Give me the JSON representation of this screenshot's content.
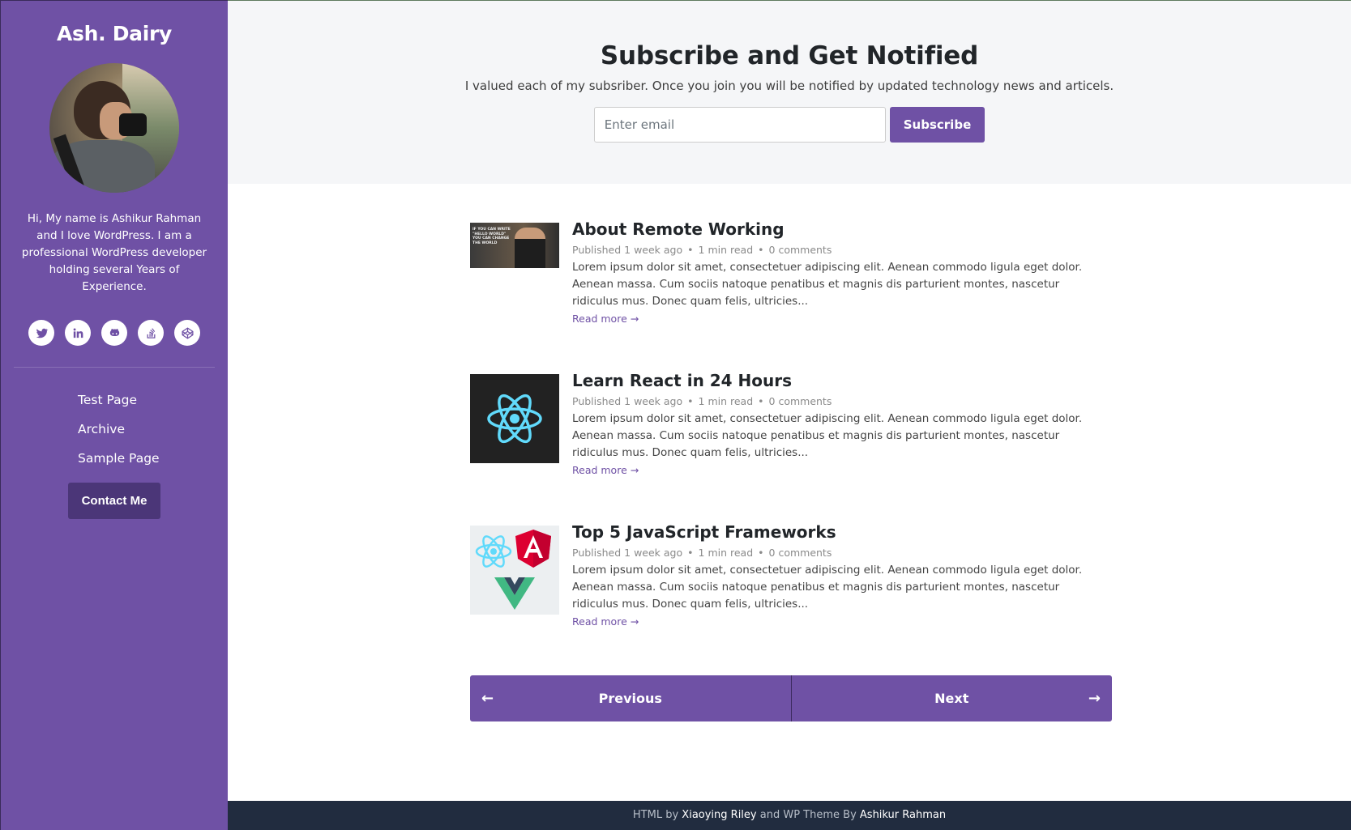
{
  "sidebar": {
    "site_title": "Ash. Dairy",
    "bio": "Hi, My name is Ashikur Rahman and I love WordPress. I am a professional WordPress developer holding several Years of Experience.",
    "social_icons": [
      "twitter-icon",
      "linkedin-icon",
      "github-icon",
      "stackoverflow-icon",
      "codepen-icon"
    ],
    "nav": [
      {
        "label": "Test Page"
      },
      {
        "label": "Archive"
      },
      {
        "label": "Sample Page"
      }
    ],
    "contact_label": "Contact Me"
  },
  "subscribe": {
    "title": "Subscribe and Get Notified",
    "description": "I valued each of my subsriber. Once you join you will be notified by updated technology news and articels.",
    "email_placeholder": "Enter email",
    "button_label": "Subscribe"
  },
  "posts": [
    {
      "title": "About Remote Working",
      "published": "Published 1 week ago",
      "read_time": "1 min read",
      "comments": "0 comments",
      "excerpt": "Lorem ipsum dolor sit amet, consectetuer adipiscing elit. Aenean commodo ligula eget dolor. Aenean massa. Cum sociis natoque penatibus et magnis dis parturient montes, nascetur ridiculus mus. Donec quam felis, ultricies...",
      "read_more": "Read more →",
      "thumb_text": "IF YOU CAN WRITE \"HELLO WORLD\" YOU CAN CHANGE THE WORLD"
    },
    {
      "title": "Learn React in 24 Hours",
      "published": "Published 1 week ago",
      "read_time": "1 min read",
      "comments": "0 comments",
      "excerpt": "Lorem ipsum dolor sit amet, consectetuer adipiscing elit. Aenean commodo ligula eget dolor. Aenean massa. Cum sociis natoque penatibus et magnis dis parturient montes, nascetur ridiculus mus. Donec quam felis, ultricies...",
      "read_more": "Read more →"
    },
    {
      "title": "Top 5 JavaScript Frameworks",
      "published": "Published 1 week ago",
      "read_time": "1 min read",
      "comments": "0 comments",
      "excerpt": "Lorem ipsum dolor sit amet, consectetuer adipiscing elit. Aenean commodo ligula eget dolor. Aenean massa. Cum sociis natoque penatibus et magnis dis parturient montes, nascetur ridiculus mus. Donec quam felis, ultricies...",
      "read_more": "Read more →"
    }
  ],
  "pagination": {
    "prev_label": "Previous",
    "next_label": "Next",
    "prev_arrow": "←",
    "next_arrow": "→"
  },
  "footer": {
    "prefix": "HTML by",
    "author1": "Xiaoying Riley",
    "middle": "and WP Theme By",
    "author2": "Ashikur Rahman"
  },
  "colors": {
    "accent": "#6f51a5",
    "accent_dark": "#4b3678",
    "footer_bg": "#212c3f",
    "subscribe_bg": "#f5f6f8"
  }
}
